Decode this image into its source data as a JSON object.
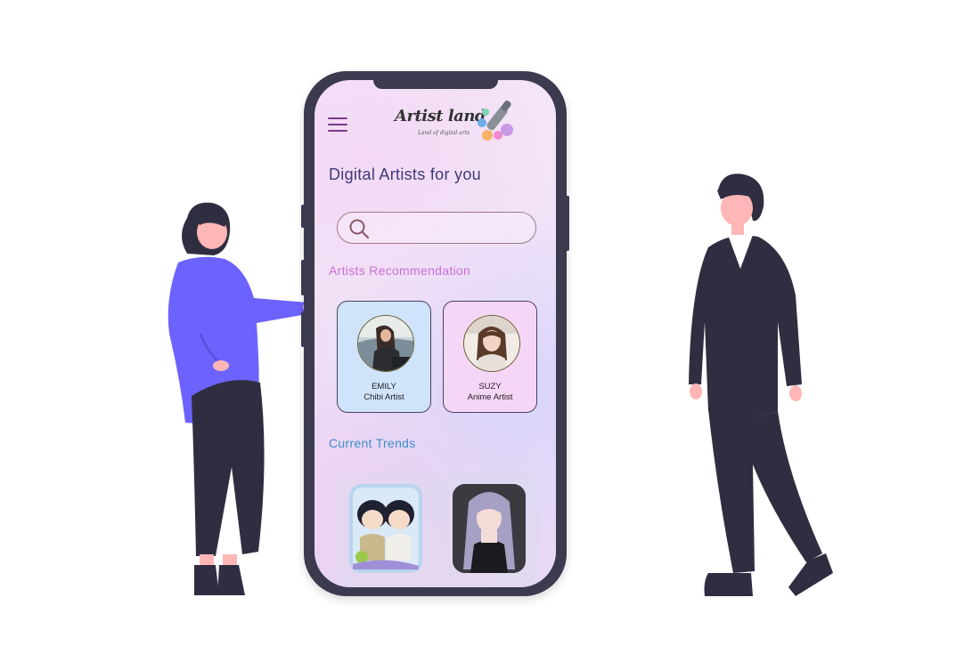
{
  "app": {
    "logo_title": "Artist land",
    "logo_subtitle": "Land of digital arts",
    "page_title": "Digital Artists for you"
  },
  "search": {
    "placeholder": "",
    "value": ""
  },
  "sections": {
    "recommendation": "Artists Recommendation",
    "trends": "Current Trends"
  },
  "artists": [
    {
      "name": "EMILY",
      "role": "Chibi Artist",
      "card_color": "#cfe3fb"
    },
    {
      "name": "SUZY",
      "role": "Anime Artist",
      "card_color": "#f6d6f6"
    }
  ],
  "trends": [
    {
      "icon": "chibi-couple-artwork"
    },
    {
      "icon": "anime-girl-portrait"
    }
  ],
  "colors": {
    "title": "#3f3a78",
    "recommendation_label": "#c86fd6",
    "trends_label": "#3f8fc9",
    "menu": "#7a3b8c",
    "figure_dark": "#2f2e41",
    "figure_accent": "#6c63ff",
    "skin": "#ffb6b6"
  }
}
